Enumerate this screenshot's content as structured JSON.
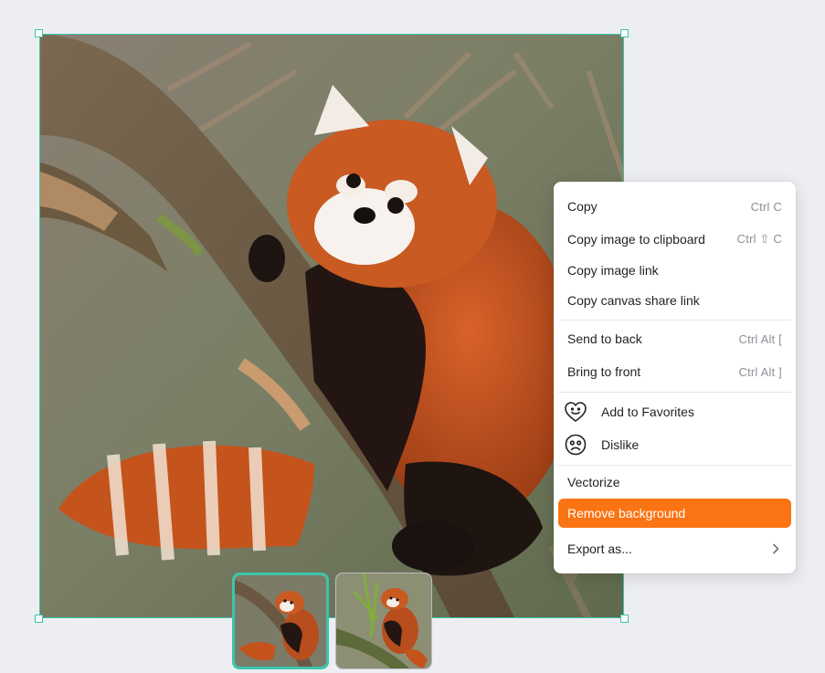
{
  "canvas": {
    "image_subject": "red panda climbing a tree",
    "thumbnails": [
      {
        "subject": "red panda on branch",
        "selected": true
      },
      {
        "subject": "red panda among bamboo",
        "selected": false
      }
    ]
  },
  "context_menu": {
    "items": {
      "copy": {
        "label": "Copy",
        "shortcut": "Ctrl C"
      },
      "copy_image_clipboard": {
        "label": "Copy image to clipboard",
        "shortcut": "Ctrl ⇧ C"
      },
      "copy_image_link": {
        "label": "Copy image link"
      },
      "copy_canvas_share_link": {
        "label": "Copy canvas share link"
      },
      "send_to_back": {
        "label": "Send to back",
        "shortcut": "Ctrl Alt ["
      },
      "bring_to_front": {
        "label": "Bring to front",
        "shortcut": "Ctrl Alt ]"
      },
      "add_to_favorites": {
        "label": "Add to Favorites",
        "icon": "heart-smile-icon"
      },
      "dislike": {
        "label": "Dislike",
        "icon": "frown-face-icon"
      },
      "vectorize": {
        "label": "Vectorize"
      },
      "remove_background": {
        "label": "Remove background"
      },
      "export_as": {
        "label": "Export as...",
        "icon": "chevron-right-icon"
      }
    }
  },
  "colors": {
    "background": "#eceef2",
    "selection": "#3cc4ac",
    "highlight": "#fb7414"
  }
}
